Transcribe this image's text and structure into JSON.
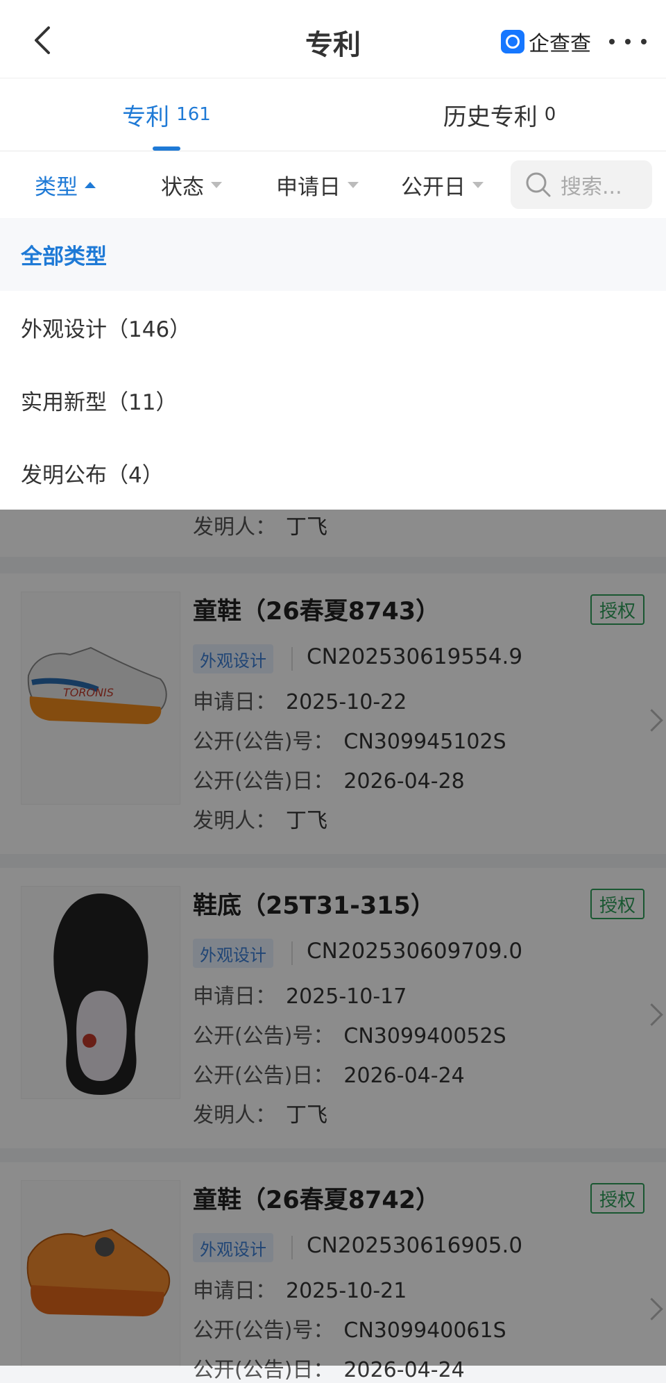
{
  "header": {
    "title": "专利",
    "brand": "企查查",
    "back_icon": "chevron-left-icon",
    "more_icon": "ellipsis-icon"
  },
  "tabs": [
    {
      "label": "专利",
      "count": "161",
      "active": true
    },
    {
      "label": "历史专利",
      "count": "0",
      "active": false
    }
  ],
  "filters": [
    {
      "label": "类型",
      "active": true
    },
    {
      "label": "状态",
      "active": false
    },
    {
      "label": "申请日",
      "active": false
    },
    {
      "label": "公开日",
      "active": false
    }
  ],
  "search": {
    "placeholder": "搜索..."
  },
  "dropdown": {
    "items": [
      {
        "label": "全部类型",
        "selected": true
      },
      {
        "label": "外观设计（146）",
        "selected": false
      },
      {
        "label": "实用新型（11）",
        "selected": false
      },
      {
        "label": "发明公布（4）",
        "selected": false
      }
    ]
  },
  "labels": {
    "apply_date": "申请日：",
    "pub_no": "公开(公告)号：",
    "pub_date": "公开(公告)日：",
    "inventor": "发明人："
  },
  "partial_card": {
    "inventor": "丁飞"
  },
  "cards": [
    {
      "title": "童鞋（26春夏8743）",
      "status": "授权",
      "type": "外观设计",
      "app_no": "CN202530619554.9",
      "apply_date": "2025-10-22",
      "pub_no": "CN309945102S",
      "pub_date": "2026-04-28",
      "inventor": "丁飞"
    },
    {
      "title": "鞋底（25T31-315）",
      "status": "授权",
      "type": "外观设计",
      "app_no": "CN202530609709.0",
      "apply_date": "2025-10-17",
      "pub_no": "CN309940052S",
      "pub_date": "2026-04-24",
      "inventor": "丁飞"
    },
    {
      "title": "童鞋（26春夏8742）",
      "status": "授权",
      "type": "外观设计",
      "app_no": "CN202530616905.0",
      "apply_date": "2025-10-21",
      "pub_no": "CN309940061S",
      "pub_date": "2026-04-24"
    }
  ]
}
